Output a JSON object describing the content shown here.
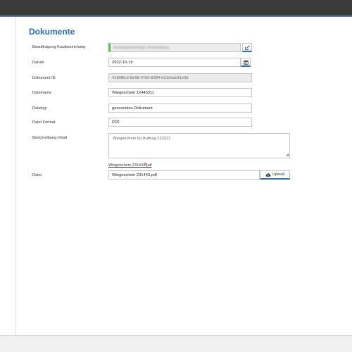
{
  "title": "Dokumente",
  "fields": {
    "beauftragung": {
      "label": "Beauftragung Kurzbezeichung",
      "value": "Gerätegenehmigt / Anmeldung"
    },
    "datum": {
      "label": "Datum",
      "value": "2022-10-19"
    },
    "dokument_id": {
      "label": "Dokument ID",
      "value": "4180f8c3-8e68-47d6-8384-b312ddc81e3b"
    },
    "dateiname": {
      "label": "Dateiname",
      "value": "Wiegeschein 12445311"
    },
    "dateityp": {
      "label": "Dateityp",
      "value": "gescanntes Dokument"
    },
    "dateiformat": {
      "label": "Datei Format",
      "value": "PDF"
    },
    "beschreibung": {
      "label": "Beschreibung Inhalt",
      "value": "Wiegeschein für Auftrag 123221"
    },
    "datei": {
      "label": "Datei",
      "value": "Wiegeschein 231443.pdf",
      "attachment": "Wiegeschein 231443.pdf",
      "upload_label": "Upload"
    }
  },
  "icons": {
    "edit": "edit-icon",
    "calendar": "calendar-icon",
    "remove": "close-icon",
    "upload": "cloud-upload-icon"
  },
  "colors": {
    "accent": "#2a6cb5",
    "topbar": "#3b3b3b",
    "remove": "#d9534f",
    "valid": "#5cb85c"
  }
}
